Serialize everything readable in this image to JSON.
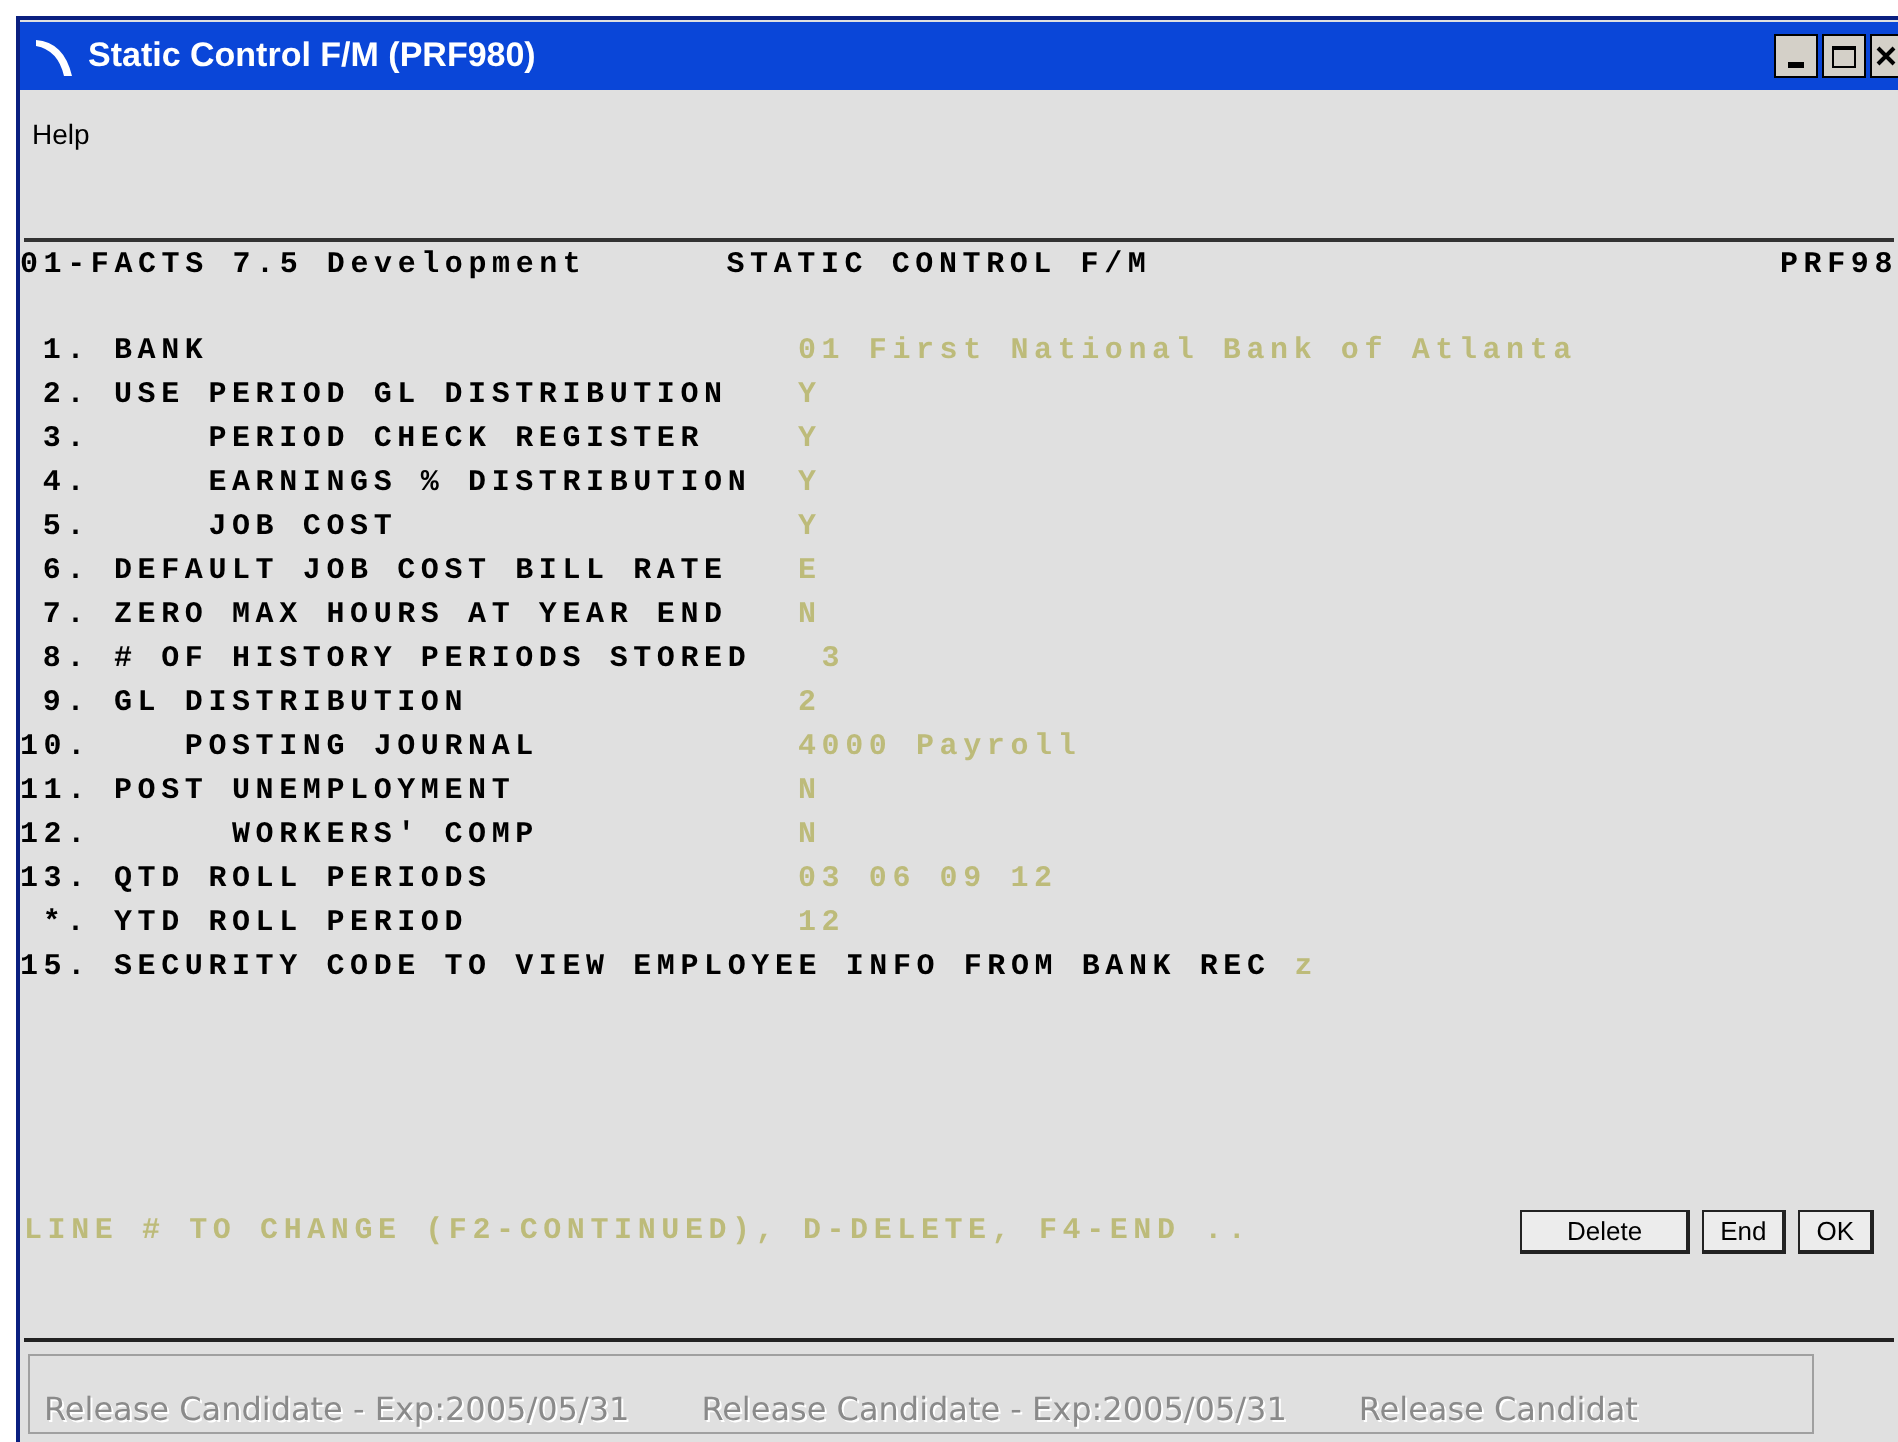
{
  "window": {
    "title": "Static Control F/M (PRF980)"
  },
  "menu": [
    "Help"
  ],
  "header": {
    "left": "01-FACTS 7.5 Development",
    "center": "STATIC CONTROL F/M",
    "right": "PRF98"
  },
  "fields": [
    {
      "number": "1.",
      "label": "BANK",
      "value": "01 First National Bank of Atlanta"
    },
    {
      "number": "2.",
      "label": "USE PERIOD GL DISTRIBUTION",
      "value": "Y"
    },
    {
      "number": "3.",
      "label": "    PERIOD CHECK REGISTER",
      "value": "Y"
    },
    {
      "number": "4.",
      "label": "    EARNINGS % DISTRIBUTION",
      "value": "Y"
    },
    {
      "number": "5.",
      "label": "    JOB COST",
      "value": "Y"
    },
    {
      "number": "6.",
      "label": "DEFAULT JOB COST BILL RATE",
      "value": "E"
    },
    {
      "number": "7.",
      "label": "ZERO MAX HOURS AT YEAR END",
      "value": "N"
    },
    {
      "number": "8.",
      "label": "# OF HISTORY PERIODS STORED",
      "value": " 3"
    },
    {
      "number": "9.",
      "label": "GL DISTRIBUTION",
      "value": "2"
    },
    {
      "number": "10.",
      "label": "   POSTING JOURNAL",
      "value": "4000 Payroll"
    },
    {
      "number": "11.",
      "label": "POST UNEMPLOYMENT",
      "value": "N"
    },
    {
      "number": "12.",
      "label": "     WORKERS' COMP",
      "value": "N"
    },
    {
      "number": "13.",
      "label": "QTD ROLL PERIODS",
      "value": "03 06 09 12"
    },
    {
      "number": "*.",
      "label": "YTD ROLL PERIOD",
      "value": "12"
    },
    {
      "number": "15.",
      "label": "SECURITY CODE TO VIEW EMPLOYEE INFO FROM BANK REC",
      "value": "z"
    }
  ],
  "prompt": "LINE # TO CHANGE (F2-CONTINUED), D-DELETE, F4-END ..",
  "buttons": [
    "Delete",
    "End",
    "OK"
  ],
  "status_bar": [
    "Release Candidate - Exp:2005/05/31",
    "Release Candidate - Exp:2005/05/31",
    "Release Candidat"
  ]
}
